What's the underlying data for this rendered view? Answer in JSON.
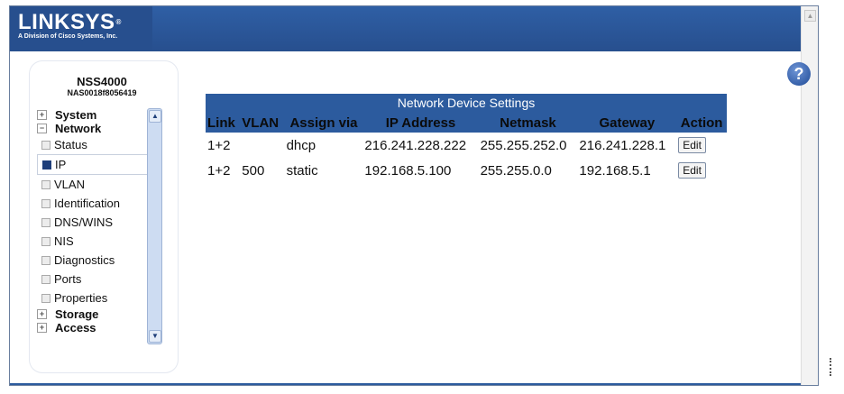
{
  "header": {
    "brand": "LINKSYS",
    "tagline": "A Division of Cisco Systems, Inc."
  },
  "sidebar": {
    "device_name": "NSS4000",
    "device_serial": "NAS0018f8056419",
    "items": [
      {
        "label": "System",
        "level": "top",
        "expand": "+"
      },
      {
        "label": "Network",
        "level": "top",
        "expand": "−"
      },
      {
        "label": "Status",
        "level": "sub"
      },
      {
        "label": "IP",
        "level": "sub",
        "active": true
      },
      {
        "label": "VLAN",
        "level": "sub"
      },
      {
        "label": "Identification",
        "level": "sub"
      },
      {
        "label": "DNS/WINS",
        "level": "sub"
      },
      {
        "label": "NIS",
        "level": "sub"
      },
      {
        "label": "Diagnostics",
        "level": "sub"
      },
      {
        "label": "Ports",
        "level": "sub"
      },
      {
        "label": "Properties",
        "level": "sub"
      },
      {
        "label": "Storage",
        "level": "top",
        "expand": "+"
      },
      {
        "label": "Access",
        "level": "top",
        "expand": "+"
      }
    ]
  },
  "help": {
    "label": "?"
  },
  "table": {
    "title": "Network Device Settings",
    "columns": [
      "Link",
      "VLAN",
      "Assign via",
      "IP Address",
      "Netmask",
      "Gateway",
      "Action"
    ],
    "rows": [
      {
        "link": "1+2",
        "vlan": "",
        "assign": "dhcp",
        "ip": "216.241.228.222",
        "netmask": "255.255.252.0",
        "gateway": "216.241.228.1",
        "action": "Edit"
      },
      {
        "link": "1+2",
        "vlan": "500",
        "assign": "static",
        "ip": "192.168.5.100",
        "netmask": "255.255.0.0",
        "gateway": "192.168.5.1",
        "action": "Edit"
      }
    ]
  }
}
